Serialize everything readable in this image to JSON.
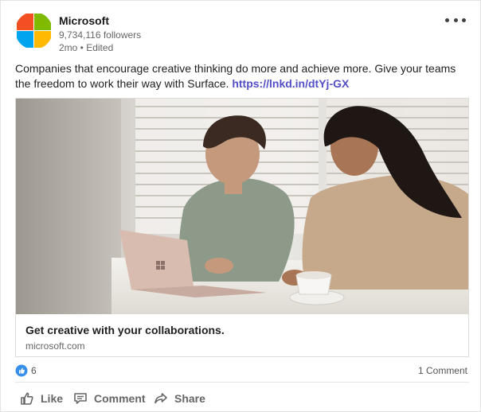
{
  "post": {
    "author": "Microsoft",
    "followers": "9,734,116 followers",
    "meta": "2mo • Edited",
    "caption_text": "Companies that encourage creative thinking do more and achieve more. Give your teams the freedom to work their way with Surface. ",
    "caption_link": "https://lnkd.in/dtYj-GX"
  },
  "logo": {
    "icon": "microsoft-logo-icon",
    "colors": [
      "#f25022",
      "#7fba00",
      "#00a4ef",
      "#ffb900"
    ]
  },
  "card": {
    "image_description_icon": "photo-image",
    "title": "Get creative with your collaborations.",
    "domain": "microsoft.com"
  },
  "stats": {
    "reaction_icon": "like-reaction-icon",
    "reactions": "6",
    "comments": "1 Comment"
  },
  "actions": {
    "like": "Like",
    "comment": "Comment",
    "share": "Share"
  },
  "colors": {
    "link": "#5350c6",
    "reaction_blue": "#378fe9",
    "muted_text": "#666666"
  }
}
